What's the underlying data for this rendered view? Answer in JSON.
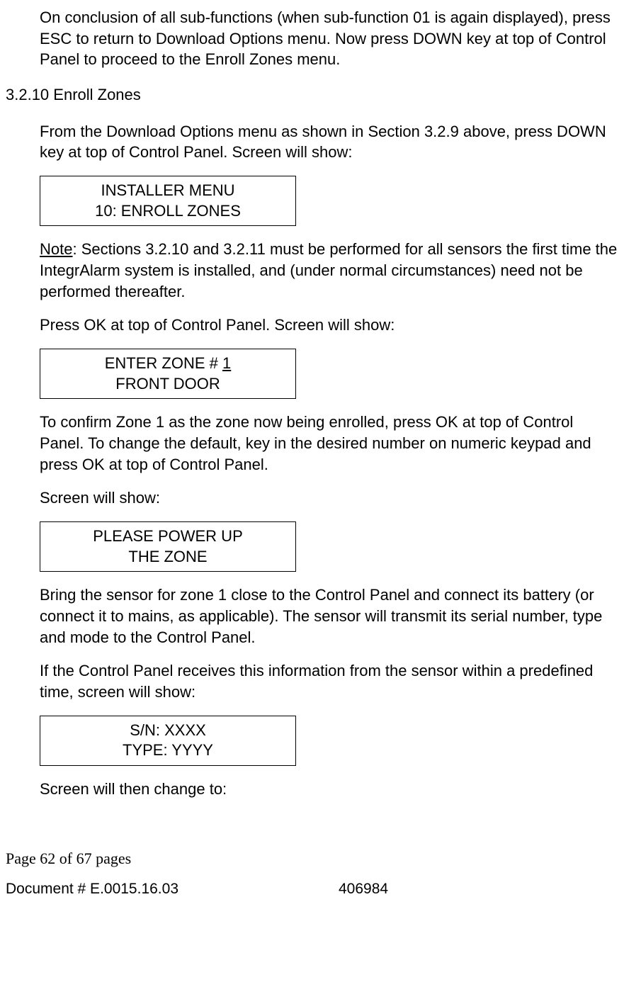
{
  "intro_para": "On conclusion of all sub-functions (when sub-function 01 is again displayed), press ESC to return to Download Options menu. Now press DOWN key at top of Control Panel to proceed to the Enroll Zones menu.",
  "section_number": "3.2.10 Enroll Zones",
  "para1": "From the Download Options menu as shown in Section 3.2.9 above, press DOWN key at top of Control Panel. Screen will show:",
  "lcd1": {
    "line1": "INSTALLER MENU",
    "line2": "10: ENROLL ZONES"
  },
  "note_label": "Note",
  "note_text": ": Sections 3.2.10 and 3.2.11 must be performed for all sensors the first time the IntegrAlarm system is installed, and (under normal circumstances) need not be performed thereafter.",
  "para2": "Press OK at top of Control Panel. Screen will show:",
  "lcd2": {
    "line1_prefix": "ENTER ZONE # ",
    "line1_value": "1",
    "line2": "FRONT DOOR"
  },
  "para3": "To confirm Zone 1 as the zone now being enrolled, press OK at top of Control Panel. To change the default, key in the desired number on numeric keypad and press OK at top of Control Panel.",
  "para4": "Screen will show:",
  "lcd3": {
    "line1": "PLEASE POWER UP",
    "line2": "THE ZONE"
  },
  "para5": "Bring the sensor for zone 1 close to the Control Panel and connect its battery (or connect it to mains, as applicable). The sensor will transmit its serial number, type and mode to the Control Panel.",
  "para6": "If the Control Panel receives this information from the sensor within a predefined time, screen will show:",
  "lcd4": {
    "line1": "S/N: XXXX",
    "line2": "TYPE: YYYY"
  },
  "para7": "Screen will then change to:",
  "footer": {
    "page_info": "Page 62 of  67 pages",
    "doc_number": "Document # E.0015.16.03",
    "code": "406984"
  }
}
